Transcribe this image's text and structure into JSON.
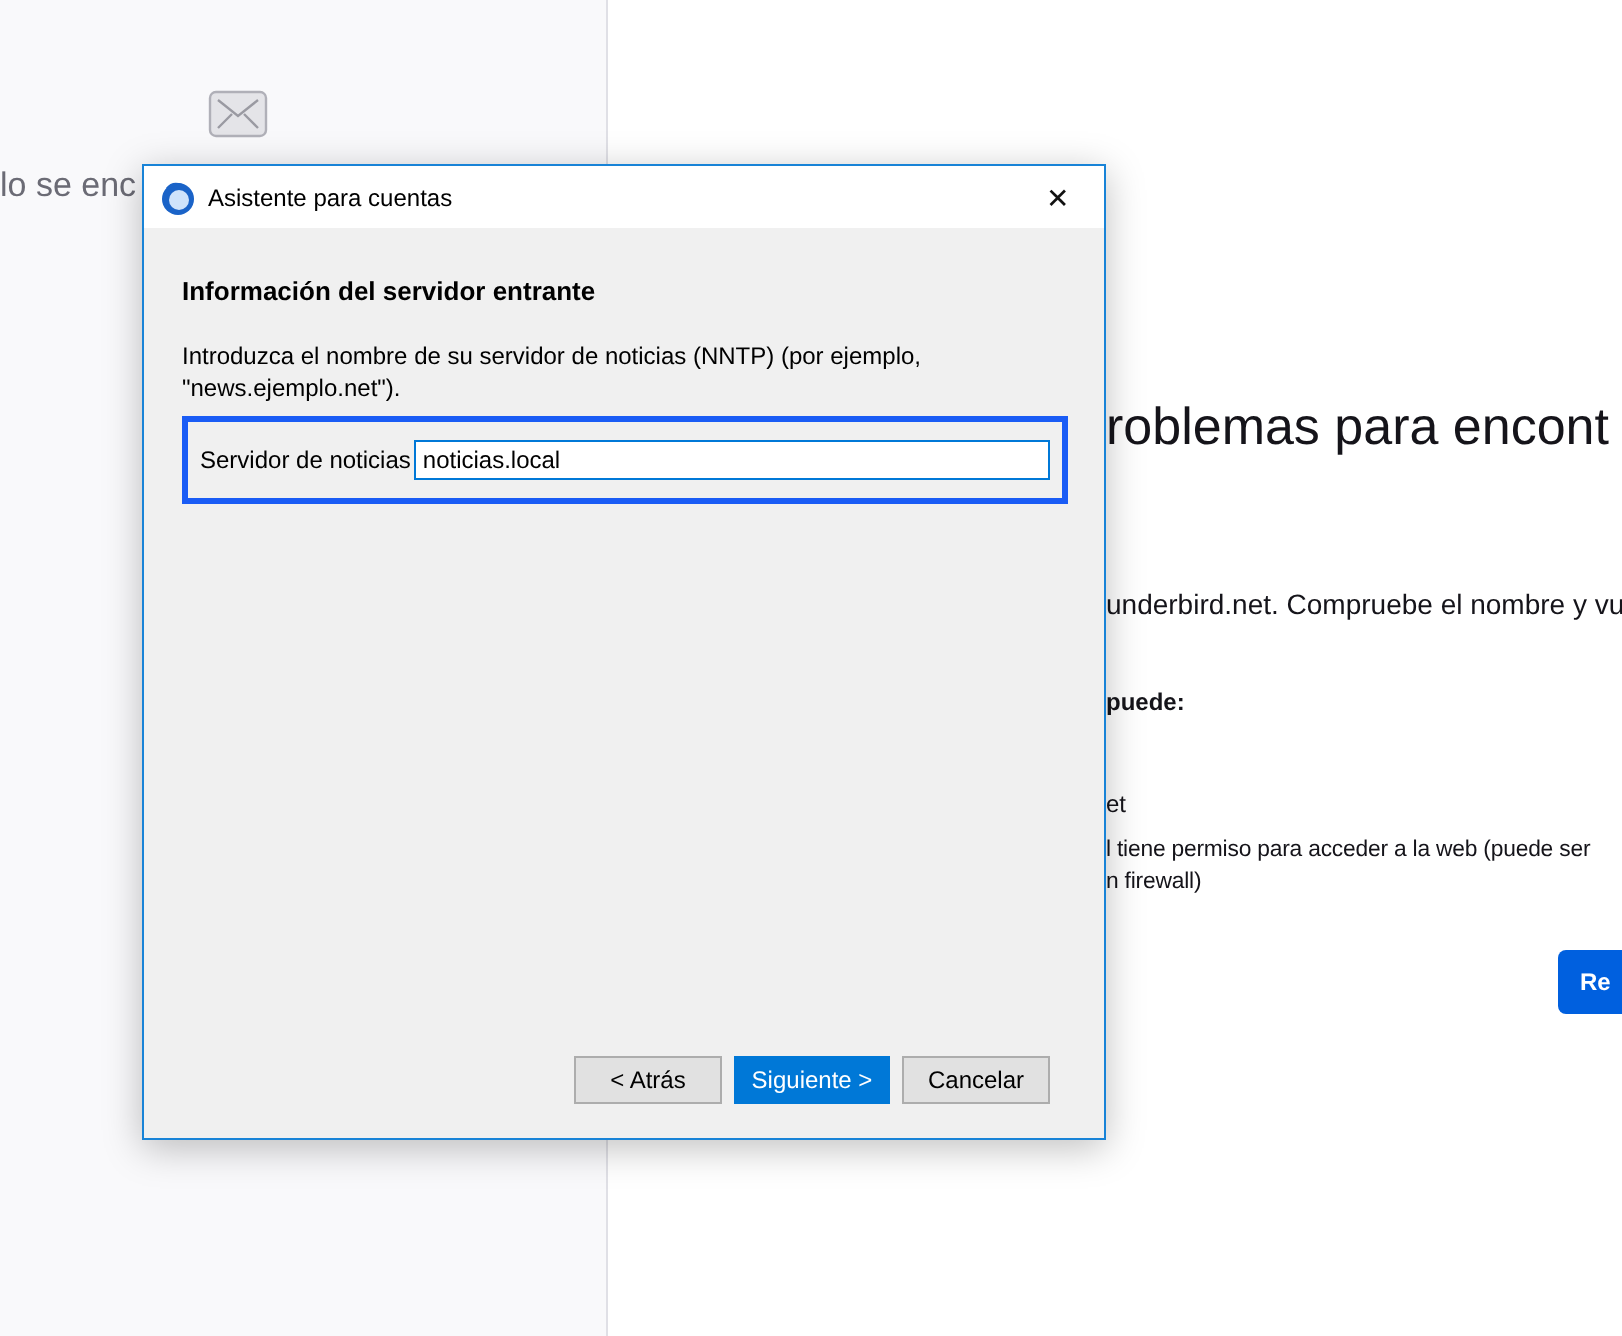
{
  "background": {
    "sidebar_text": "lo se enc",
    "heading": "roblemas para encont",
    "paragraphs": [
      {
        "text": "underbird.net. Compruebe el nombre y vu",
        "kind": "normal"
      },
      {
        "text": "puede:",
        "kind": "bold"
      },
      {
        "text": "et",
        "kind": "normal"
      },
      {
        "text": "l tiene permiso para acceder a la web (puede ser\nn firewall)",
        "kind": "normal"
      }
    ],
    "button": "Re"
  },
  "dialog": {
    "title": "Asistente para cuentas",
    "close": "✕",
    "heading": "Información del servidor entrante",
    "description": "Introduzca el nombre de su servidor de noticias (NNTP) (por ejemplo, \"news.ejemplo.net\").",
    "field": {
      "label": "Servidor de noticias",
      "value": "noticias.local"
    },
    "buttons": [
      {
        "label": "< Atrás",
        "kind": "secondary"
      },
      {
        "label": "Siguiente >",
        "kind": "primary"
      },
      {
        "label": "Cancelar",
        "kind": "secondary"
      }
    ]
  }
}
